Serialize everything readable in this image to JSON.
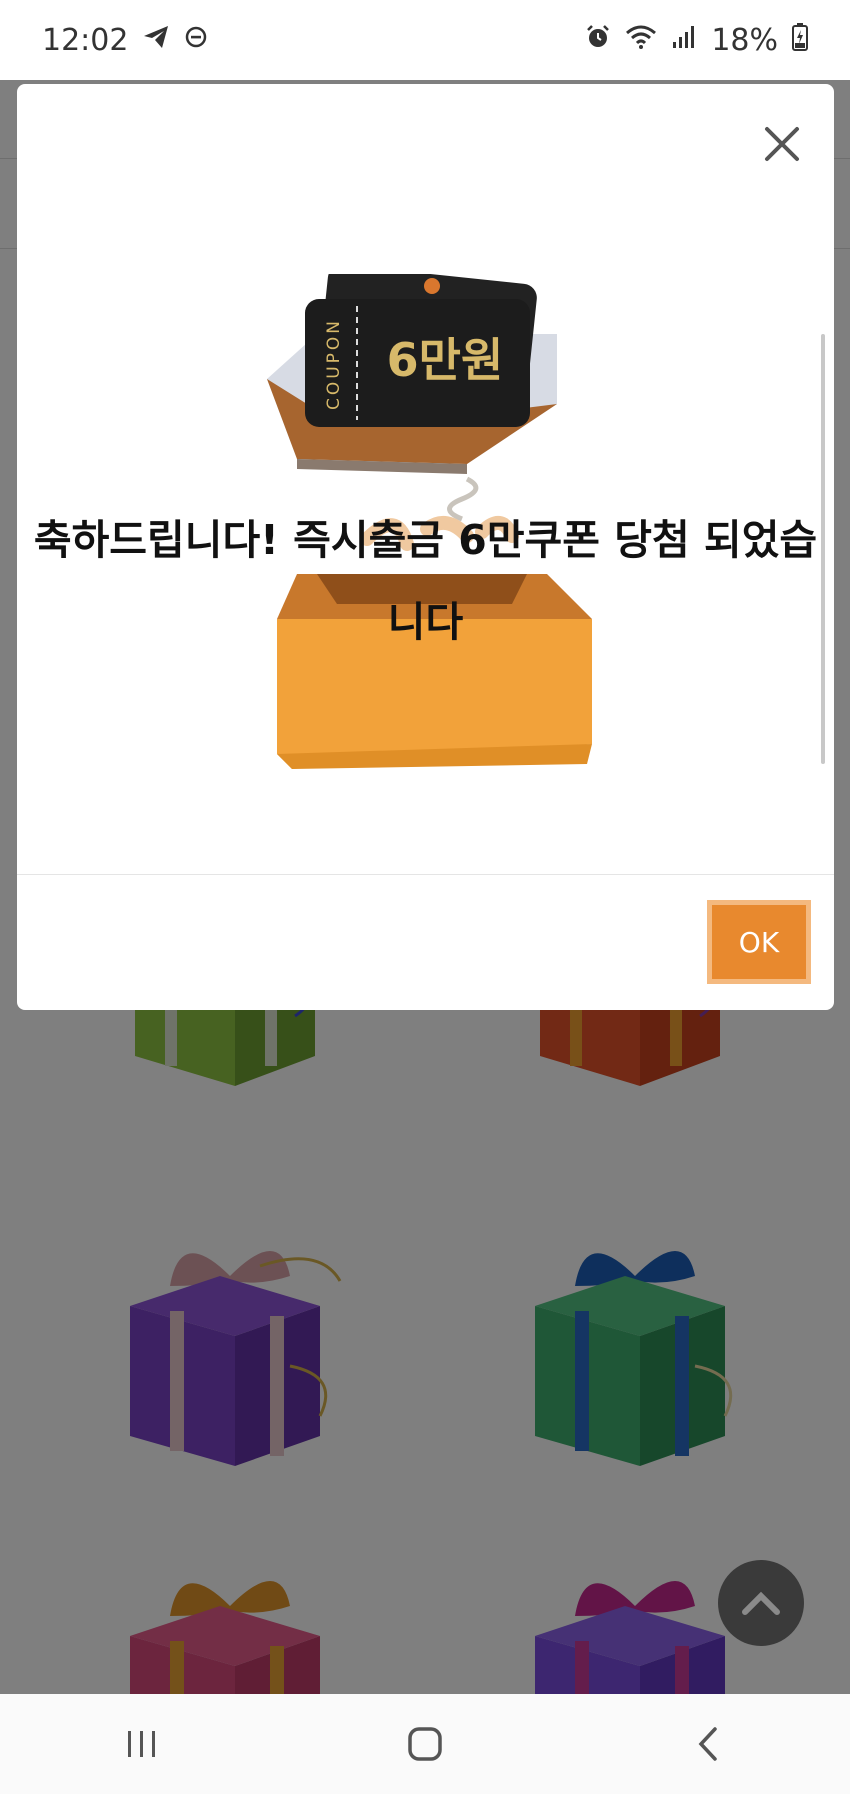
{
  "status_bar": {
    "time": "12:02",
    "battery": "18%",
    "icons": [
      "telegram-icon",
      "do-not-disturb-icon",
      "alarm-icon",
      "wifi-icon",
      "signal-icon",
      "battery-icon"
    ]
  },
  "modal": {
    "coupon_label": "COUPON",
    "coupon_amount": "6만원",
    "message": "축하드립니다! 즉시출금 6만쿠폰 당첨 되었습니다",
    "ok_label": "OK"
  },
  "colors": {
    "accent": "#e8892e",
    "overlay": "rgba(0,0,0,0.5)"
  },
  "navbar": {
    "icons": [
      "recent-apps-icon",
      "home-icon",
      "back-icon"
    ]
  }
}
